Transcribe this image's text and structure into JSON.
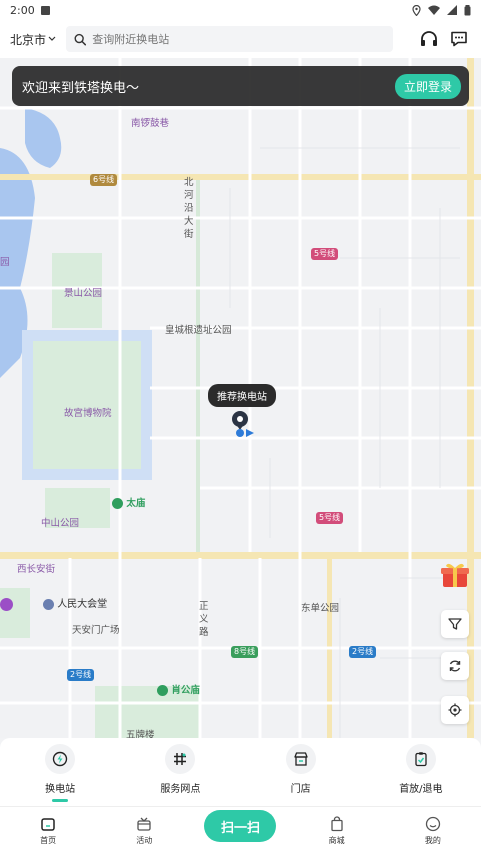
{
  "status_bar": {
    "time": "2:00"
  },
  "header": {
    "city": "北京市",
    "search_placeholder": "查询附近换电站",
    "support_icon": "headset-icon",
    "message_icon": "message-icon"
  },
  "banner": {
    "text": "欢迎来到铁塔换电～",
    "button": "立即登录"
  },
  "map": {
    "labels": {
      "nanluoguxiang": "南锣鼓巷",
      "beiheyan": "北河沿大街",
      "jingshan": "景山公园",
      "huangcheng": "皇城根遗址公园",
      "gugong": "故宫博物院",
      "taimiao": "太庙",
      "zhongshan": "中山公园",
      "xichangan": "西长安街",
      "renmin": "人民大会堂",
      "tiananmen": "天安门广场",
      "zhengyi": "正义路",
      "dongdan": "东单公园",
      "xiaogongyuan": "肖公庙",
      "yuan": "园",
      "wuyuan": "五牌楼"
    },
    "lines": {
      "l6": "6号线",
      "l5a": "5号线",
      "l5b": "5号线",
      "l8": "8号线",
      "l2a": "2号线",
      "l2b": "2号线"
    },
    "marker_tooltip": "推荐换电站"
  },
  "categories": [
    {
      "label": "换电站",
      "icon": "battery-station-icon",
      "active": true
    },
    {
      "label": "服务网点",
      "icon": "service-point-icon",
      "active": false
    },
    {
      "label": "门店",
      "icon": "store-icon",
      "active": false
    },
    {
      "label": "首放/退电",
      "icon": "clipboard-icon",
      "active": false
    }
  ],
  "bottom_nav": {
    "home": "首页",
    "activity": "活动",
    "scan": "扫一扫",
    "mall": "商城",
    "mine": "我的"
  },
  "colors": {
    "accent": "#2ec9a7",
    "banner_bg": "#282828"
  }
}
